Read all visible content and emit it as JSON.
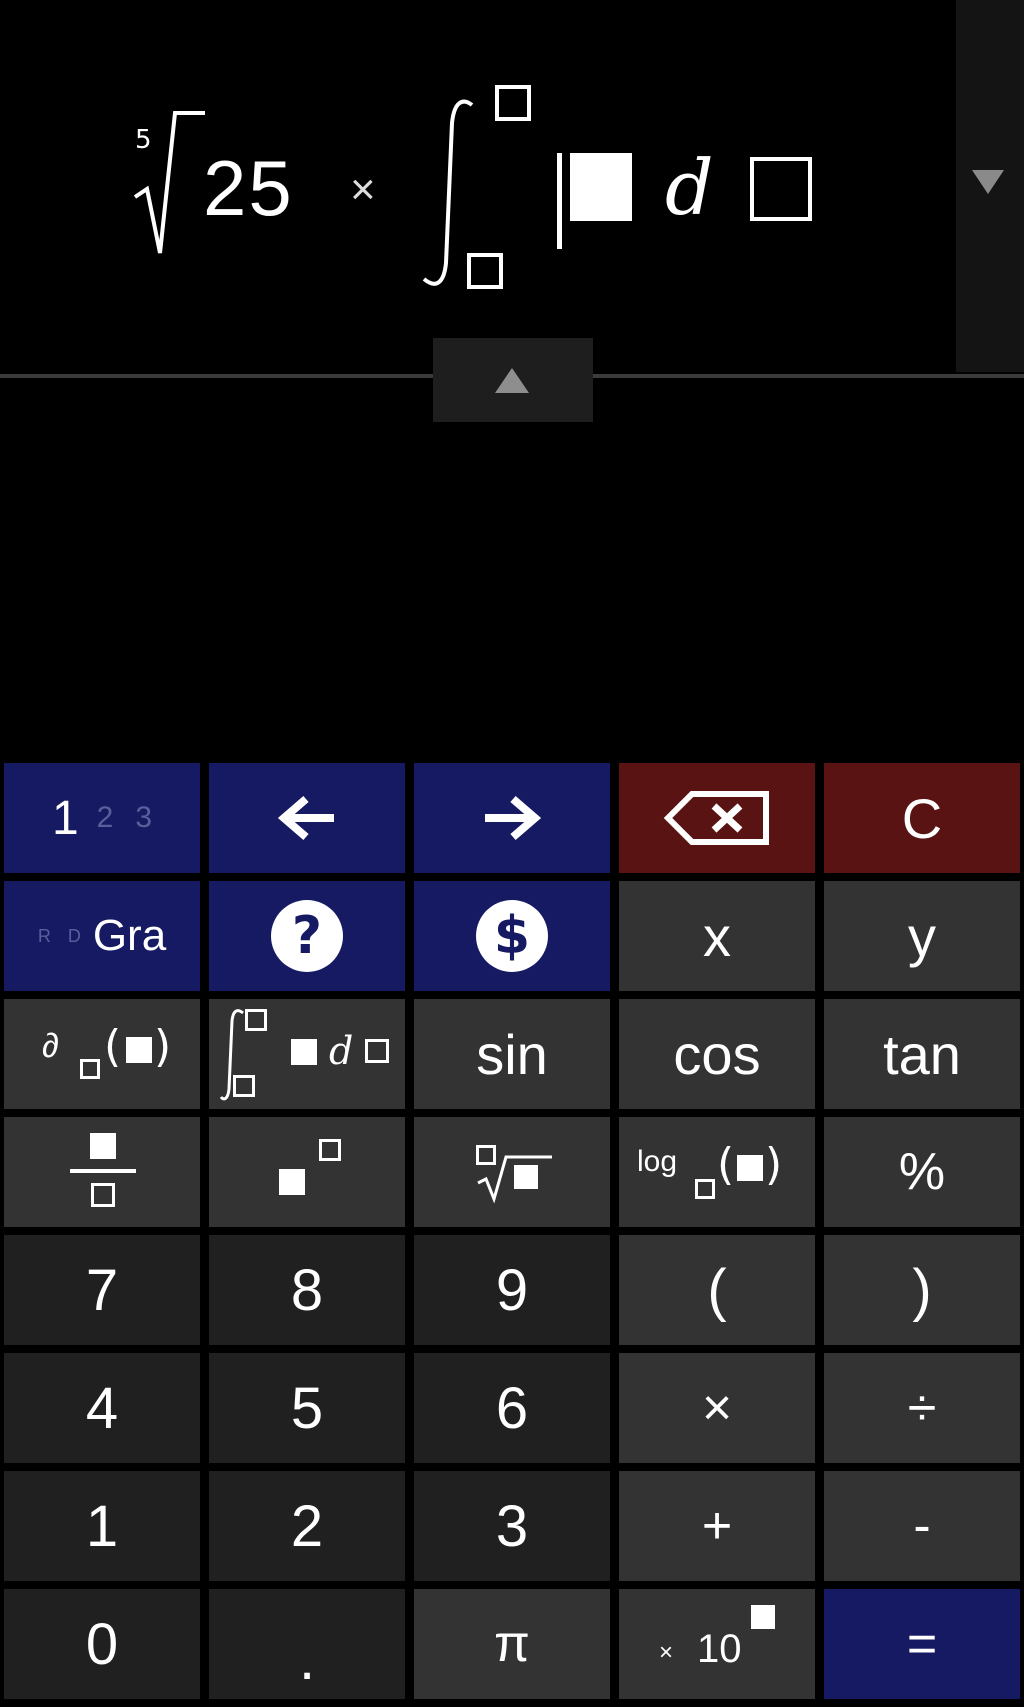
{
  "expression": {
    "root_index": "5",
    "radicand": "25",
    "operator": "×",
    "differential": "d"
  },
  "icons": {
    "history": "chevron-down-icon",
    "expand": "chevron-up-icon",
    "back": "arrow-left-icon",
    "forward": "arrow-right-icon",
    "backspace": "backspace-icon",
    "help": "question-icon",
    "currency": "dollar-icon"
  },
  "colors": {
    "accent_blue": "#161a63",
    "danger_red": "#5a1313",
    "key_gray": "#333333",
    "key_dark": "#202020",
    "background": "#000000"
  },
  "keypad": {
    "mode": {
      "active": "1",
      "inactive": [
        "2",
        "3"
      ]
    },
    "clear": "C",
    "angle": {
      "inactive": "R D",
      "active": "Gra"
    },
    "help_symbol": "?",
    "currency_symbol": "$",
    "var_x": "x",
    "var_y": "y",
    "deriv_symbol": "∂",
    "integral_d": "d",
    "sin": "sin",
    "cos": "cos",
    "tan": "tan",
    "log": "log",
    "percent": "%",
    "digits": [
      "0",
      "1",
      "2",
      "3",
      "4",
      "5",
      "6",
      "7",
      "8",
      "9"
    ],
    "open_paren": "(",
    "close_paren": ")",
    "multiply": "×",
    "divide": "÷",
    "plus": "+",
    "minus": "-",
    "decimal": ".",
    "pi": "π",
    "sci_times": "×",
    "sci_ten": "10",
    "equals": "="
  }
}
